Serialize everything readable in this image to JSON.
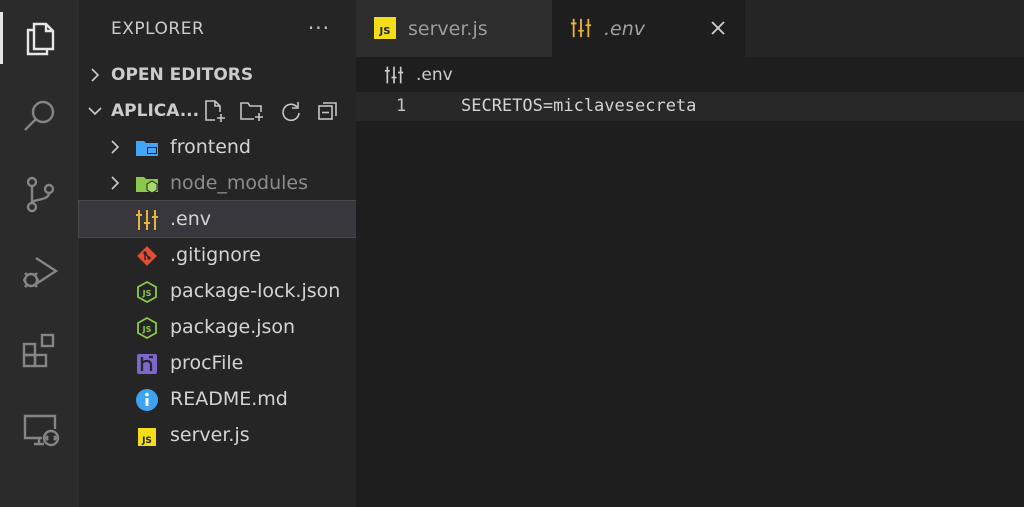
{
  "sidebar": {
    "title": "EXPLORER",
    "more": "···",
    "open_editors": "OPEN EDITORS",
    "project": "APLICA...",
    "items": [
      {
        "label": "frontend",
        "icon": "folder-frontend-icon"
      },
      {
        "label": "node_modules",
        "icon": "folder-node-icon"
      },
      {
        "label": ".env",
        "icon": "env-settings-icon"
      },
      {
        "label": ".gitignore",
        "icon": "git-icon"
      },
      {
        "label": "package-lock.json",
        "icon": "nodejs-icon"
      },
      {
        "label": "package.json",
        "icon": "nodejs-icon"
      },
      {
        "label": "procFile",
        "icon": "heroku-icon"
      },
      {
        "label": "README.md",
        "icon": "info-icon"
      },
      {
        "label": "server.js",
        "icon": "javascript-icon"
      }
    ]
  },
  "tabs": [
    {
      "label": "server.js",
      "badge": "JS"
    },
    {
      "label": ".env"
    }
  ],
  "breadcrumb": {
    "label": ".env"
  },
  "editor": {
    "lines": [
      {
        "num": "1",
        "code": "SECRETOS=miclavesecreta"
      }
    ]
  },
  "colors": {
    "js_yellow": "#f5de19",
    "env_yellow": "#e8b339",
    "node_green": "#8cc84b",
    "git_orange": "#e24e31",
    "heroku_purple": "#7b68c9",
    "info_blue": "#3ea3f0",
    "folder_blue": "#42a5f5"
  }
}
